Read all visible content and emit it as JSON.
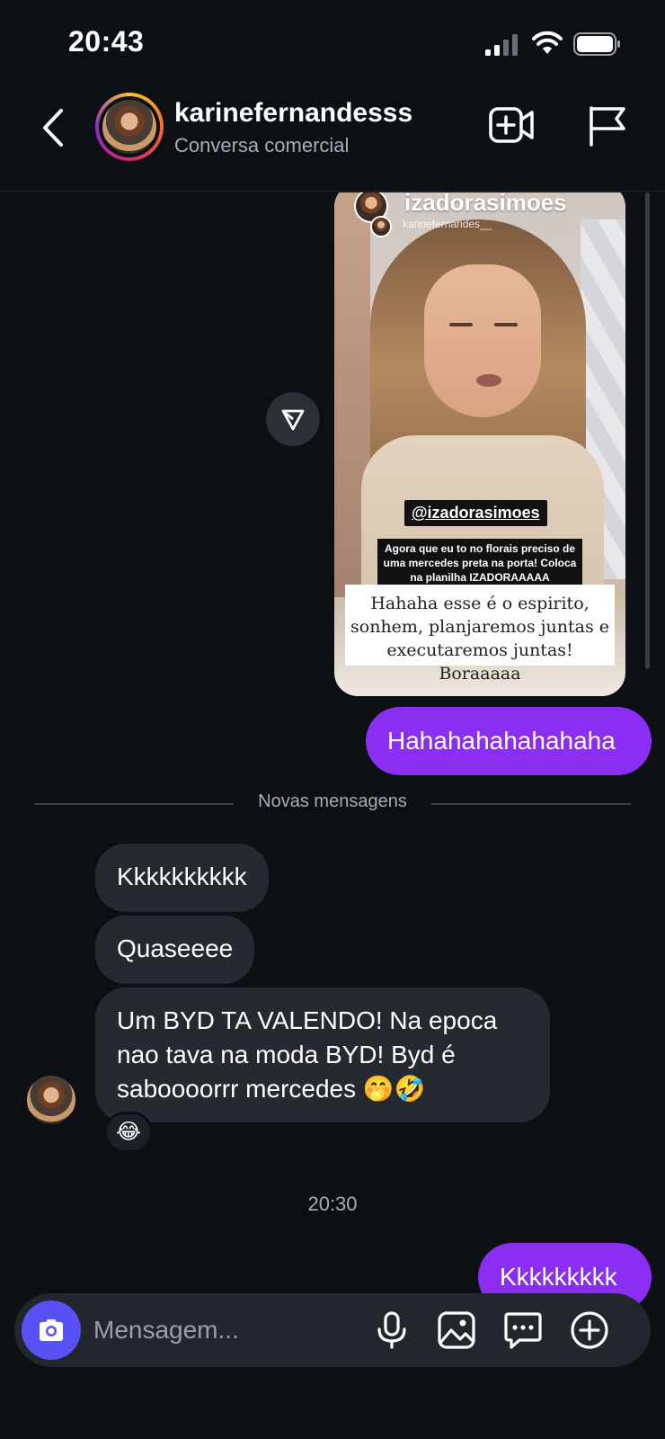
{
  "status_bar": {
    "time": "20:43"
  },
  "header": {
    "contact_name": "karinefernandesss",
    "subtitle": "Conversa comercial"
  },
  "shared_story": {
    "username": "izadorasimoes",
    "sub_username": "karinefernandes__",
    "mention": "@izadorasimoes",
    "caption": "Agora que eu to no florais preciso de uma mercedes preta na porta! Coloca na planilha IZADORAAAAA",
    "quote": "Hahaha esse é o espirito, sonhem, planjaremos juntas e executaremos juntas! Boraaaaa"
  },
  "messages": {
    "out_1": "Hahahahahahahaha",
    "divider": "Novas mensagens",
    "in_1": "Kkkkkkkkkk",
    "in_2": "Quaseeee",
    "in_3": "Um BYD TA VALENDO! Na epoca nao tava na moda BYD! Byd é saboooorrr mercedes 🤭🤣",
    "reaction": "😂",
    "timestamp": "20:30",
    "out_2": "Kkkkkkkkk"
  },
  "composer": {
    "placeholder": "Mensagem..."
  },
  "colors": {
    "accent_purple": "#8a2ef2",
    "camera_blue": "#5851f5",
    "background": "#0c0f14",
    "incoming_bubble": "#262930"
  }
}
